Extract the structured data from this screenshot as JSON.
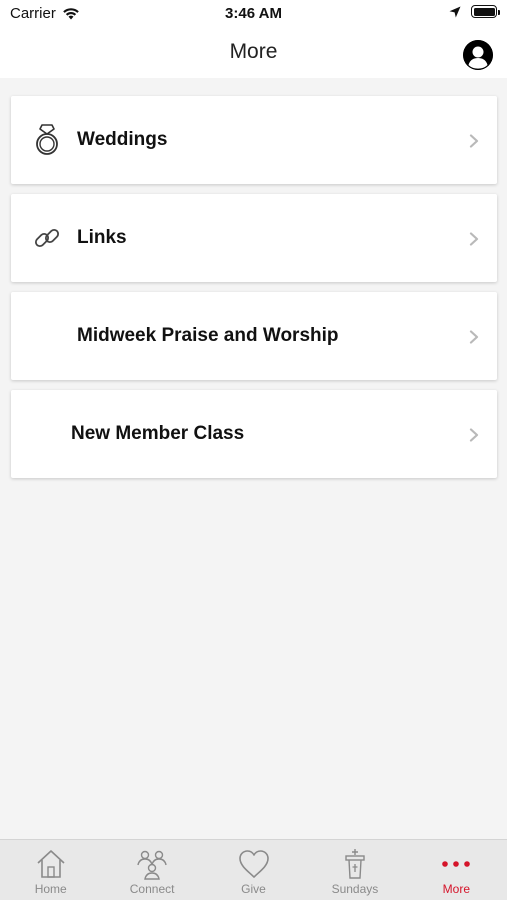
{
  "status_bar": {
    "carrier": "Carrier",
    "time": "3:46 AM"
  },
  "nav": {
    "title": "More"
  },
  "items": [
    {
      "label": "Weddings",
      "icon": "ring-icon"
    },
    {
      "label": "Links",
      "icon": "link-icon"
    },
    {
      "label": "Midweek Praise and Worship",
      "icon": ""
    },
    {
      "label": "New Member Class",
      "icon": ""
    }
  ],
  "tabs": [
    {
      "label": "Home",
      "icon": "home-icon",
      "active": false
    },
    {
      "label": "Connect",
      "icon": "people-icon",
      "active": false
    },
    {
      "label": "Give",
      "icon": "heart-icon",
      "active": false
    },
    {
      "label": "Sundays",
      "icon": "pulpit-icon",
      "active": false
    },
    {
      "label": "More",
      "icon": "more-dots-icon",
      "active": true
    }
  ],
  "colors": {
    "accent": "#d5142a",
    "inactive_tab": "#8a8a8a"
  }
}
